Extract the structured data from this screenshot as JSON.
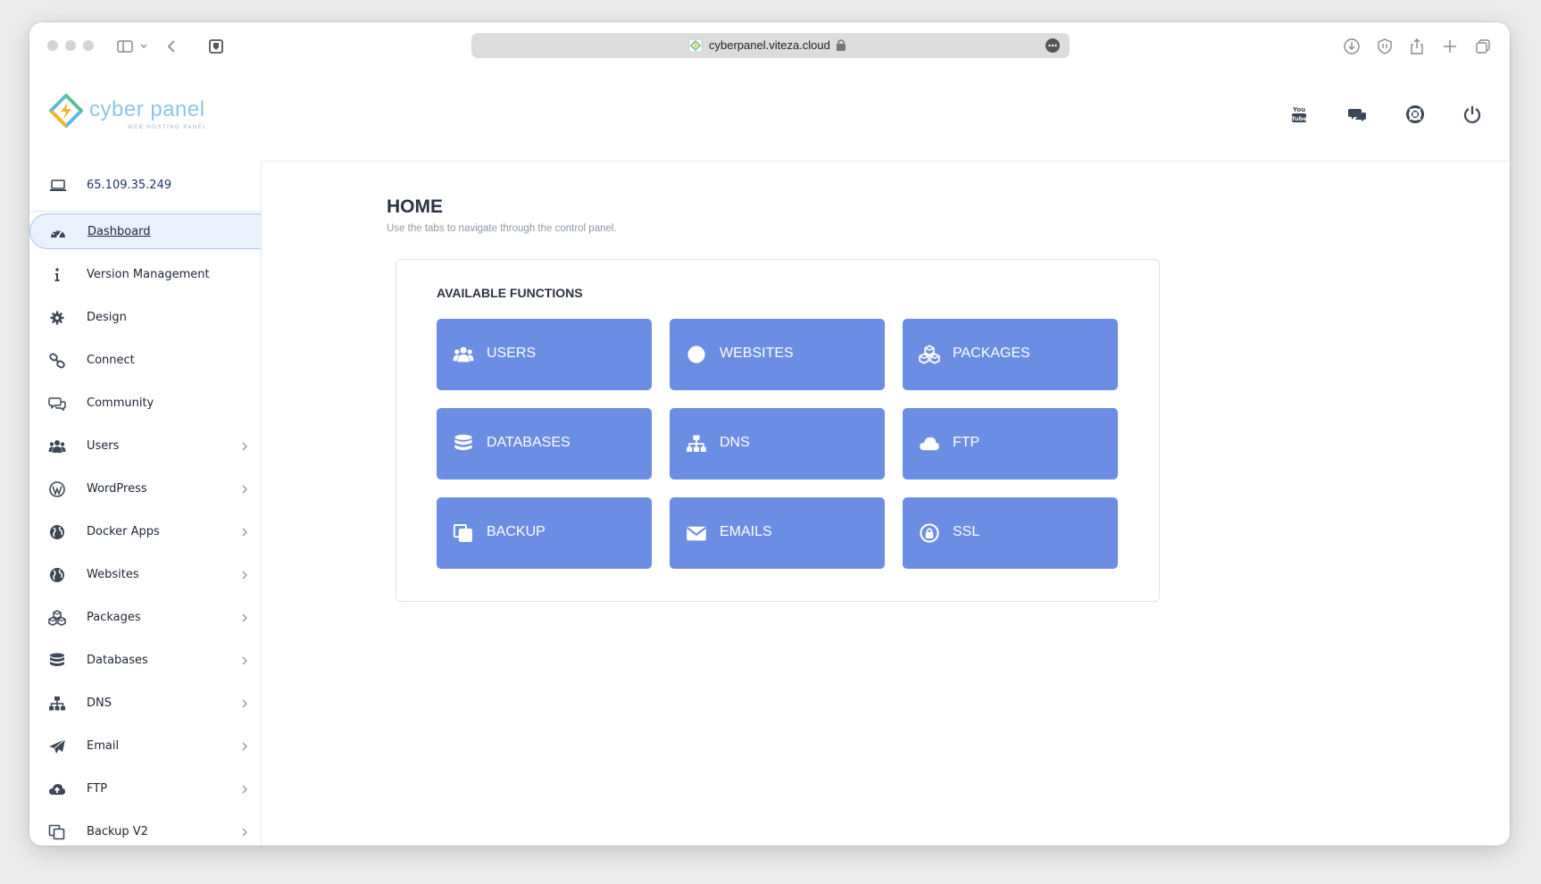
{
  "browser": {
    "url": "cyberpanel.viteza.cloud"
  },
  "app": {
    "logo_text": "cyber panel",
    "logo_sub": "WEB HOSTING PANEL",
    "header_icons": [
      "youtube-icon",
      "chat-icon",
      "support-icon",
      "power-icon"
    ]
  },
  "sidebar": {
    "ip": "65.109.35.249",
    "items": [
      {
        "label": "Dashboard",
        "icon": "dashboard-icon",
        "active": true,
        "chevron": false
      },
      {
        "label": "Version Management",
        "icon": "info-icon",
        "chevron": false
      },
      {
        "label": "Design",
        "icon": "gear-icon",
        "chevron": false
      },
      {
        "label": "Connect",
        "icon": "link-icon",
        "chevron": false
      },
      {
        "label": "Community",
        "icon": "comments-icon",
        "chevron": false
      },
      {
        "label": "Users",
        "icon": "users-icon",
        "chevron": true
      },
      {
        "label": "WordPress",
        "icon": "wordpress-icon",
        "chevron": true
      },
      {
        "label": "Docker Apps",
        "icon": "globe-icon",
        "chevron": true
      },
      {
        "label": "Websites",
        "icon": "globe-icon",
        "chevron": true
      },
      {
        "label": "Packages",
        "icon": "cubes-icon",
        "chevron": true
      },
      {
        "label": "Databases",
        "icon": "database-icon",
        "chevron": true
      },
      {
        "label": "DNS",
        "icon": "sitemap-icon",
        "chevron": true
      },
      {
        "label": "Email",
        "icon": "paper-plane-icon",
        "chevron": true
      },
      {
        "label": "FTP",
        "icon": "cloud-upload-icon",
        "chevron": true
      },
      {
        "label": "Backup V2",
        "icon": "copy-icon",
        "chevron": true
      }
    ]
  },
  "main": {
    "title": "HOME",
    "subtitle": "Use the tabs to navigate through the control panel.",
    "panel_title": "AVAILABLE FUNCTIONS",
    "functions": [
      {
        "label": "USERS",
        "icon": "users-icon"
      },
      {
        "label": "WEBSITES",
        "icon": "globe-icon"
      },
      {
        "label": "PACKAGES",
        "icon": "cubes-icon"
      },
      {
        "label": "DATABASES",
        "icon": "database-icon"
      },
      {
        "label": "DNS",
        "icon": "sitemap-icon"
      },
      {
        "label": "FTP",
        "icon": "cloud-upload-icon"
      },
      {
        "label": "BACKUP",
        "icon": "copy-icon"
      },
      {
        "label": "EMAILS",
        "icon": "envelope-icon"
      },
      {
        "label": "SSL",
        "icon": "lock-icon"
      }
    ]
  },
  "colors": {
    "accent": "#6b8de3",
    "active_bg": "#eaf1fd",
    "text_dark": "#2b3342"
  }
}
